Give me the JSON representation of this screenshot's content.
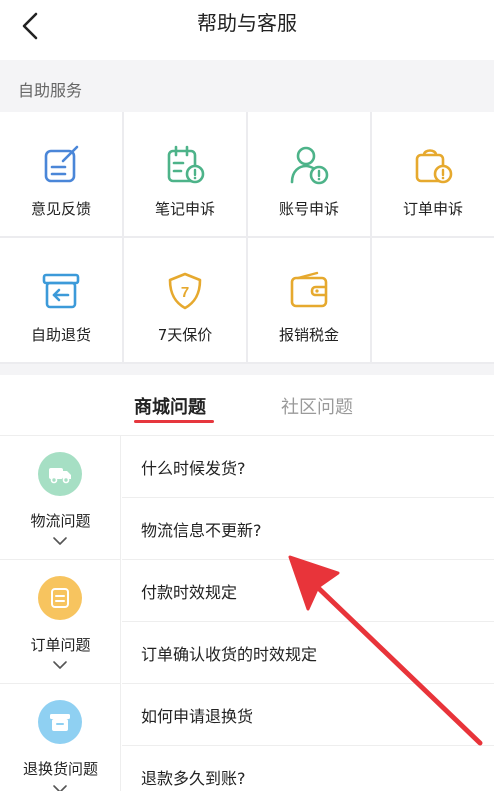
{
  "nav": {
    "title": "帮助与客服"
  },
  "self_service": {
    "label": "自助服务",
    "items": [
      {
        "label": "意见反馈",
        "icon": "feedback-icon",
        "color": "#4a86d8"
      },
      {
        "label": "笔记申诉",
        "icon": "note-appeal-icon",
        "color": "#4db389"
      },
      {
        "label": "账号申诉",
        "icon": "account-appeal-icon",
        "color": "#4db389"
      },
      {
        "label": "订单申诉",
        "icon": "order-appeal-icon",
        "color": "#e6a92e"
      },
      {
        "label": "自助退货",
        "icon": "return-box-icon",
        "color": "#3c9ad9"
      },
      {
        "label": "7天保价",
        "icon": "price-protect-shield-icon",
        "color": "#e6a92e",
        "glyph": "7"
      },
      {
        "label": "报销税金",
        "icon": "wallet-icon",
        "color": "#e6a92e"
      }
    ]
  },
  "tabs": [
    {
      "label": "商城问题",
      "active": true
    },
    {
      "label": "社区问题",
      "active": false
    }
  ],
  "categories": [
    {
      "label": "物流问题",
      "icon": "truck-icon",
      "bg": "#a6dfc4"
    },
    {
      "label": "订单问题",
      "icon": "order-icon",
      "bg": "#f7c45f"
    },
    {
      "label": "退换货问题",
      "icon": "return-icon",
      "bg": "#8fd0f2"
    }
  ],
  "questions": [
    "什么时候发货?",
    "物流信息不更新?",
    "付款时效规定",
    "订单确认收货的时效规定",
    "如何申请退换货",
    "退款多久到账?"
  ],
  "colors": {
    "accent": "#e6373e",
    "annotation_arrow": "#e8343a"
  }
}
